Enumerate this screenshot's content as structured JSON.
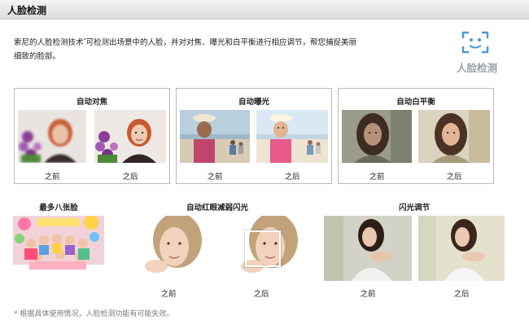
{
  "header": {
    "title": "人脸检测"
  },
  "intro": {
    "line1_pre": "索尼的人脸检测技术",
    "line1_sup": "*",
    "line1_post": "可检测出场景中的人脸，并对对焦、曝光和白平衡进行相应调节，帮您捕捉美丽",
    "line2": "细致的脸部。"
  },
  "logo": {
    "caption": "人脸检测",
    "icon": "face-detect-icon"
  },
  "boxes": [
    {
      "title": "自动对焦",
      "before": "之前",
      "after": "之后"
    },
    {
      "title": "自动曝光",
      "before": "之前",
      "after": "之后"
    },
    {
      "title": "自动白平衡",
      "before": "之前",
      "after": "之后"
    }
  ],
  "bottom": {
    "group1": {
      "title": "最多八张脸"
    },
    "group2": {
      "title": "自动红眼减弱闪光",
      "before": "之前",
      "after": "之后"
    },
    "group3": {
      "title": "闪光调节",
      "before": "之前",
      "after": "之后"
    }
  },
  "footnote": "* 根据具体使用情况，人脸检测功能有可能失效。",
  "colors": {
    "logo_blue": "#4a9ad8",
    "logo_text": "#9aa2a8",
    "border": "#bbbbbb"
  }
}
